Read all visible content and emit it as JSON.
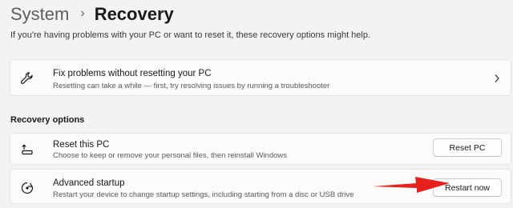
{
  "breadcrumb": {
    "parent": "System",
    "separator": "›",
    "current": "Recovery"
  },
  "intro_text": "If you're having problems with your PC or want to reset it, these recovery options might help.",
  "fix_card": {
    "icon": "wrench-icon",
    "title": "Fix problems without resetting your PC",
    "description": "Resetting can take a while — first, try resolving issues by running a troubleshooter",
    "chevron": "chevron-right-icon"
  },
  "recovery_options": {
    "heading": "Recovery options",
    "reset": {
      "icon": "reset-pc-icon",
      "title": "Reset this PC",
      "description": "Choose to keep or remove your personal files, then reinstall Windows",
      "button_label": "Reset PC"
    },
    "advanced": {
      "icon": "advanced-startup-icon",
      "title": "Advanced startup",
      "description": "Restart your device to change startup settings, including starting from a disc or USB drive",
      "button_label": "Restart now"
    }
  },
  "colors": {
    "background": "#f3f3f3",
    "card": "#fbfbfb",
    "arrow": "#e8201c"
  }
}
